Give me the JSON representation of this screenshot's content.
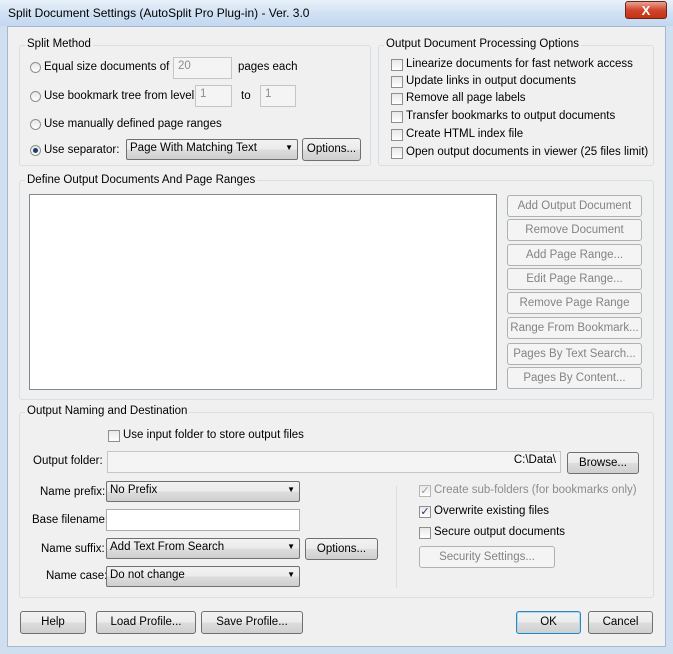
{
  "window": {
    "title": "Split Document Settings (AutoSplit Pro Plug-in) - Ver. 3.0",
    "close_glyph": "X"
  },
  "split_method": {
    "label": "Split Method",
    "equal_size_label": "Equal size documents of",
    "equal_size_value": "20",
    "pages_each_label": "pages each",
    "bookmark_label": "Use bookmark tree from level",
    "bookmark_from": "1",
    "to_label": "to",
    "bookmark_to": "1",
    "manual_label": "Use manually defined page ranges",
    "separator_label": "Use separator:",
    "separator_value": "Page With Matching Text",
    "options_label": "Options..."
  },
  "processing": {
    "label": "Output Document Processing Options",
    "items": [
      {
        "label": "Linearize documents for fast network access",
        "checked": false
      },
      {
        "label": "Update links in output documents",
        "checked": false
      },
      {
        "label": "Remove all page labels",
        "checked": false
      },
      {
        "label": "Transfer bookmarks to output documents",
        "checked": false
      },
      {
        "label": "Create HTML index file",
        "checked": false
      },
      {
        "label": "Open output documents in viewer (25 files limit)",
        "checked": false
      }
    ]
  },
  "ranges": {
    "label": "Define Output Documents And Page Ranges",
    "buttons": [
      "Add Output Document",
      "Remove Document",
      "Add Page Range...",
      "Edit Page Range...",
      "Remove Page Range",
      "Range From Bookmark...",
      "Pages By Text Search...",
      "Pages By Content..."
    ]
  },
  "naming": {
    "label": "Output Naming and Destination",
    "use_input_folder_label": "Use input folder to store output files",
    "output_folder_label": "Output folder:",
    "output_folder_value": "C:\\Data\\",
    "browse_label": "Browse...",
    "name_prefix_label": "Name prefix:",
    "name_prefix_value": "No Prefix",
    "base_filename_label": "Base filename:",
    "base_filename_value": "",
    "name_suffix_label": "Name suffix:",
    "name_suffix_value": "Add Text From Search",
    "suffix_options_label": "Options...",
    "name_case_label": "Name case:",
    "name_case_value": "Do not change",
    "create_subfolders_label": "Create sub-folders (for bookmarks only)",
    "overwrite_label": "Overwrite existing files",
    "secure_label": "Secure output documents",
    "security_settings_label": "Security Settings..."
  },
  "footer": {
    "help": "Help",
    "load_profile": "Load Profile...",
    "save_profile": "Save Profile...",
    "ok": "OK",
    "cancel": "Cancel"
  },
  "glyphs": {
    "check": "✓",
    "dropdown": "▼"
  }
}
